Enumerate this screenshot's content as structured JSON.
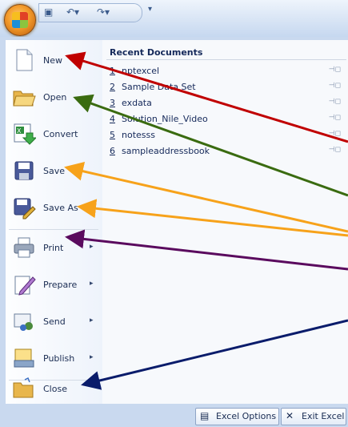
{
  "title_bar": {
    "office_button_icon": "office-logo-icon",
    "quick_access": [
      "save-icon",
      "undo-icon",
      "redo-icon"
    ],
    "customize_icon": "dropdown-icon"
  },
  "menu": {
    "items": [
      {
        "label": "New",
        "icon": "new-document-icon",
        "has_submenu": false
      },
      {
        "label": "Open",
        "icon": "open-folder-icon",
        "has_submenu": false
      },
      {
        "label": "Convert",
        "icon": "convert-icon",
        "has_submenu": false
      },
      {
        "label": "Save",
        "icon": "save-disk-icon",
        "has_submenu": false
      },
      {
        "label": "Save As",
        "icon": "save-as-icon",
        "has_submenu": true
      },
      {
        "label": "Print",
        "icon": "printer-icon",
        "has_submenu": true
      },
      {
        "label": "Prepare",
        "icon": "prepare-icon",
        "has_submenu": true
      },
      {
        "label": "Send",
        "icon": "send-icon",
        "has_submenu": true
      },
      {
        "label": "Publish",
        "icon": "publish-icon",
        "has_submenu": true
      },
      {
        "label": "Close",
        "icon": "close-folder-icon",
        "has_submenu": false
      }
    ],
    "submenu_arrow": "▸"
  },
  "recent": {
    "title": "Recent Documents",
    "pin_glyph": "⊣◻",
    "items": [
      {
        "num": "1",
        "name": "nptexcel"
      },
      {
        "num": "2",
        "name": "Sample Data Set"
      },
      {
        "num": "3",
        "name": "exdata"
      },
      {
        "num": "4",
        "name": "Solution_Nile_Video"
      },
      {
        "num": "5",
        "name": "notesss"
      },
      {
        "num": "6",
        "name": "sampleaddressbook"
      }
    ]
  },
  "footer": {
    "options_label": "Excel Options",
    "exit_label": "Exit Excel",
    "exit_glyph": "✕"
  },
  "colors": {
    "arrow_red": "#c00000",
    "arrow_green": "#3a6b10",
    "arrow_orange": "#f7a21a",
    "arrow_purple": "#5a0a5e",
    "arrow_navy": "#0a1c6b"
  }
}
